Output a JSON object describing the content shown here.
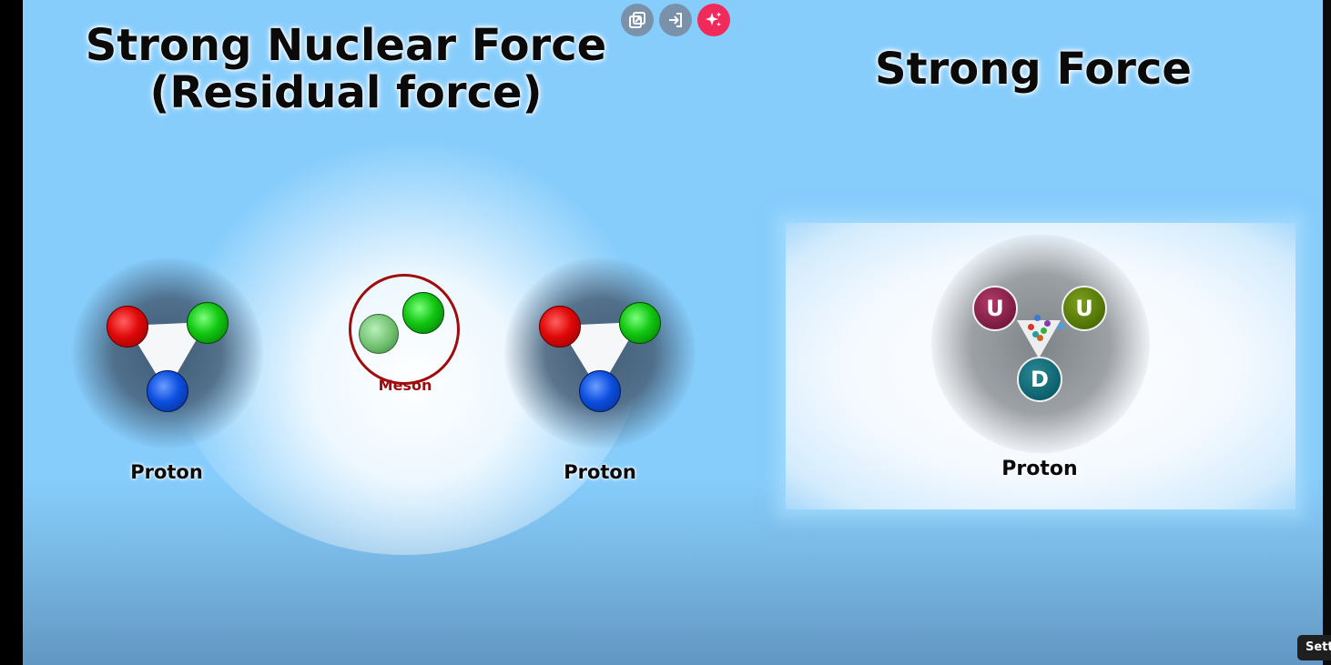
{
  "slide": {
    "left_title_line1": "Strong Nuclear Force",
    "left_title_line2": "(Residual force)",
    "right_title": "Strong Force",
    "proton_label": "Proton",
    "meson_label": "Meson",
    "quarks": {
      "up": "U",
      "down": "D"
    }
  },
  "controls": {
    "buttons": [
      {
        "icon": "popout-icon"
      },
      {
        "icon": "enter-icon"
      },
      {
        "icon": "sparkle-icon"
      }
    ]
  },
  "player": {
    "settings_label": "Settings"
  },
  "colors": {
    "background": "#86cdfc",
    "red_quark": "#e00808",
    "green_quark": "#12c712",
    "blue_quark": "#0d4fe0",
    "meson_ring": "#a00c0c",
    "up_quark_1": "#7a1a40",
    "up_quark_2": "#4e7004",
    "down_quark": "#0c5f6b",
    "accent_button": "#f2295b"
  }
}
